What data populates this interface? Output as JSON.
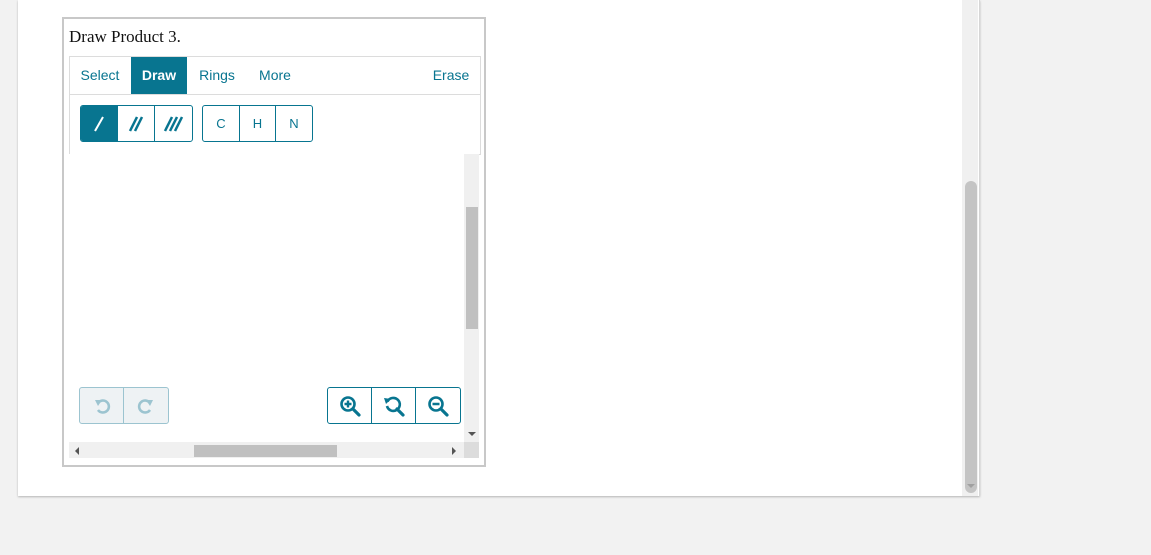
{
  "question": {
    "title": "Draw Product 3."
  },
  "editor": {
    "tabs": [
      {
        "label": "Select",
        "active": false
      },
      {
        "label": "Draw",
        "active": true
      },
      {
        "label": "Rings",
        "active": false
      },
      {
        "label": "More",
        "active": false
      },
      {
        "label": "Erase",
        "active": false
      }
    ],
    "bond_tools": [
      {
        "icon": "single-bond-icon",
        "active": true
      },
      {
        "icon": "double-bond-icon",
        "active": false
      },
      {
        "icon": "triple-bond-icon",
        "active": false
      }
    ],
    "atom_tools": [
      "C",
      "H",
      "N"
    ],
    "history_tools": [
      {
        "icon": "undo-icon",
        "enabled": false
      },
      {
        "icon": "redo-icon",
        "enabled": false
      }
    ],
    "zoom_tools": [
      {
        "icon": "zoom-in-icon"
      },
      {
        "icon": "zoom-reset-icon"
      },
      {
        "icon": "zoom-out-icon"
      }
    ]
  },
  "colors": {
    "accent": "#087590",
    "disabled": "#9cc4d0",
    "page_bg": "#f2f2f2"
  }
}
